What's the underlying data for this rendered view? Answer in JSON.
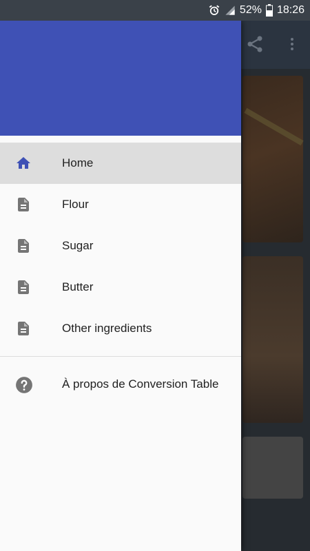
{
  "status_bar": {
    "battery_percent": "52%",
    "time": "18:26",
    "icons": [
      "alarm-icon",
      "signal-icon",
      "battery-icon"
    ]
  },
  "drawer": {
    "items": [
      {
        "label": "Home",
        "icon": "home-icon",
        "selected": true
      },
      {
        "label": "Flour",
        "icon": "document-icon",
        "selected": false
      },
      {
        "label": "Sugar",
        "icon": "document-icon",
        "selected": false
      },
      {
        "label": "Butter",
        "icon": "document-icon",
        "selected": false
      },
      {
        "label": "Other ingredients",
        "icon": "document-icon",
        "selected": false
      }
    ],
    "footer_items": [
      {
        "label": "À propos de Conversion Table",
        "icon": "help-icon"
      }
    ]
  },
  "background_toolbar": {
    "icons": [
      "share-icon",
      "more-vert-icon"
    ]
  },
  "colors": {
    "header": "#3f51b5",
    "selected_item_bg": "#dddddd",
    "active_icon": "#3f51b5",
    "inactive_icon": "#757575"
  }
}
